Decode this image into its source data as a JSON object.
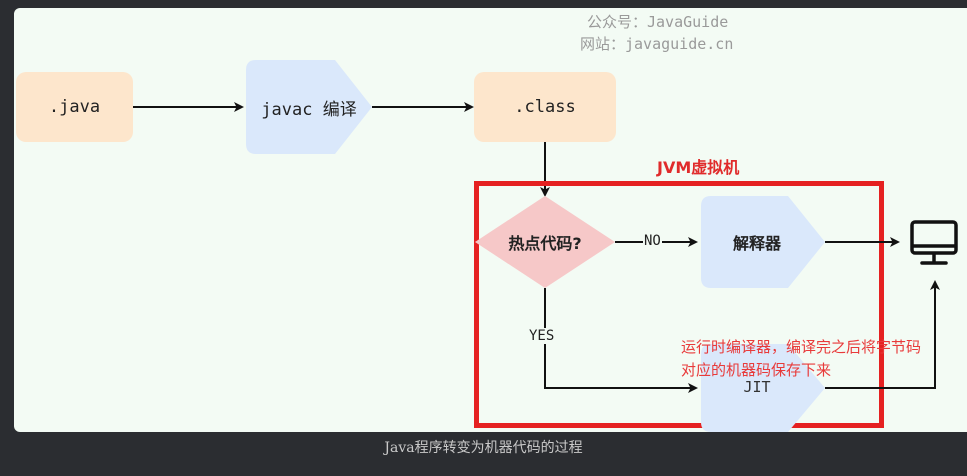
{
  "watermark": {
    "line1": "公众号：JavaGuide",
    "line2": "网站：javaguide.cn"
  },
  "nodes": {
    "java_file": ".java",
    "javac": "javac 编译",
    "class_file": ".class",
    "hot_code": "热点代码?",
    "interpreter": "解释器",
    "jit": "JIT"
  },
  "edges": {
    "no_label": "NO",
    "yes_label": "YES"
  },
  "jvm_box": {
    "title": "JVM虚拟机"
  },
  "annotation": {
    "line1": "运行时编译器，编译完之后将字节码",
    "line2": "对应的机器码保存下来"
  },
  "caption": "Java程序转变为机器代码的过程",
  "colors": {
    "orange_node": "#fde6cc",
    "blue_node": "#dae8fb",
    "pink_diamond": "#f6c8c8",
    "jvm_border": "#e52121",
    "annotation_text": "#e83a3a"
  },
  "icons": {
    "machine": "monitor-icon"
  }
}
